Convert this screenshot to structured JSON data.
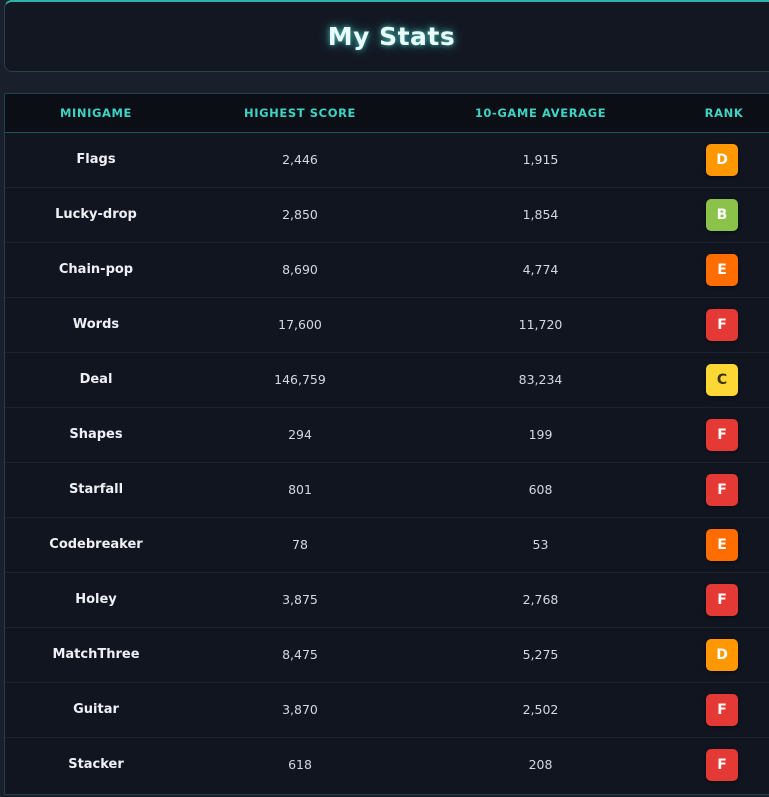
{
  "header": {
    "title": "My Stats"
  },
  "table": {
    "columns": [
      "MINIGAME",
      "HIGHEST SCORE",
      "10-GAME AVERAGE",
      "RANK"
    ],
    "rows": [
      {
        "game": "Flags",
        "highest": "2,446",
        "average": "1,915",
        "rank": "D"
      },
      {
        "game": "Lucky-drop",
        "highest": "2,850",
        "average": "1,854",
        "rank": "B"
      },
      {
        "game": "Chain-pop",
        "highest": "8,690",
        "average": "4,774",
        "rank": "E"
      },
      {
        "game": "Words",
        "highest": "17,600",
        "average": "11,720",
        "rank": "F"
      },
      {
        "game": "Deal",
        "highest": "146,759",
        "average": "83,234",
        "rank": "C"
      },
      {
        "game": "Shapes",
        "highest": "294",
        "average": "199",
        "rank": "F"
      },
      {
        "game": "Starfall",
        "highest": "801",
        "average": "608",
        "rank": "F"
      },
      {
        "game": "Codebreaker",
        "highest": "78",
        "average": "53",
        "rank": "E"
      },
      {
        "game": "Holey",
        "highest": "3,875",
        "average": "2,768",
        "rank": "F"
      },
      {
        "game": "MatchThree",
        "highest": "8,475",
        "average": "5,275",
        "rank": "D"
      },
      {
        "game": "Guitar",
        "highest": "3,870",
        "average": "2,502",
        "rank": "F"
      },
      {
        "game": "Stacker",
        "highest": "618",
        "average": "208",
        "rank": "F"
      }
    ]
  },
  "rank_colors": {
    "B": "#8bc34a",
    "C": "#fdd835",
    "D": "#ff9800",
    "E": "#ff6d00",
    "F": "#e53935"
  },
  "theme": {
    "accent": "#3ed3c2",
    "background": "#111520"
  }
}
